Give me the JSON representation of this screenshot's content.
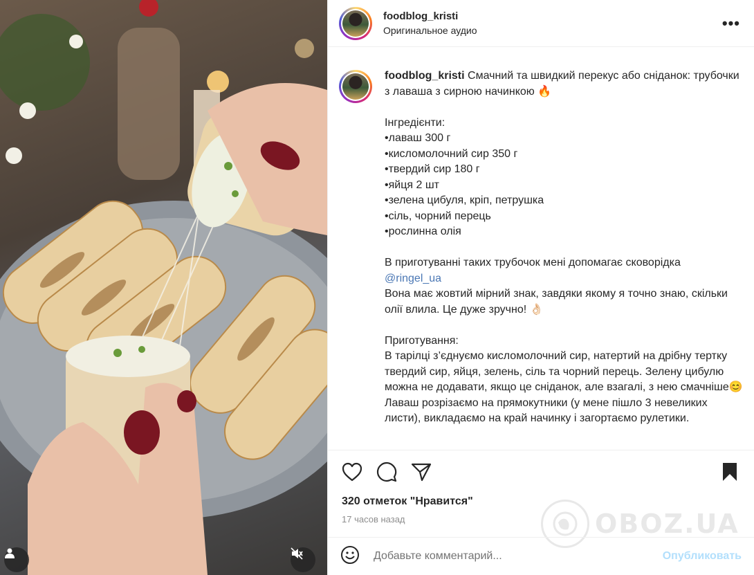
{
  "post": {
    "username": "foodblog_kristi",
    "audio": "Оригинальное аудио",
    "more_label": "•••",
    "caption_username": "foodblog_kristi",
    "caption_intro": " Смачний та швидкий перекус або сніданок: трубочки з лаваша з сирною начинкою 🔥\n\nІнгредієнти:\n•лаваш 300 г\n•кисломолочний сир 350 г\n•твердий сир 180 г\n•яйця 2 шт\n•зелена цибуля, кріп, петрушка\n•сіль, чорний перець\n•рослинна олія\n\nВ приготуванні таких трубочок мені допомагає сковорідка\n",
    "mention": "@ringel_ua",
    "caption_rest": "\nВона має жовтий мірний знак, завдяки якому я точно знаю, скільки олії влила. Це дуже зручно! 👌🏻\n\nПриготування:\nВ тарілці з’єднуємо кисломолочний сир, натертий на дрібну тертку твердий сир, яйця, зелень, сіль та чорний перець. Зелену цибулю можна не додавати, якщо це сніданок, але взагалі, з нею смачніше😊\nЛаваш розрізаємо на прямокутники (у мене пішло 3 невеликих листи), викладаємо на край начинку і загортаємо рулетики.",
    "likes": "320 отметок \"Нравится\"",
    "time": "17 часов назад"
  },
  "comment": {
    "placeholder": "Добавьте комментарий...",
    "publish_label": "Опубликовать"
  },
  "watermark": {
    "text": "OBOZ.UA"
  },
  "icons": {
    "like": "heart-icon",
    "comment": "comment-icon",
    "share": "share-icon",
    "save": "bookmark-icon",
    "emoji": "emoji-icon",
    "user": "user-tag-icon",
    "mute": "muted-icon"
  }
}
